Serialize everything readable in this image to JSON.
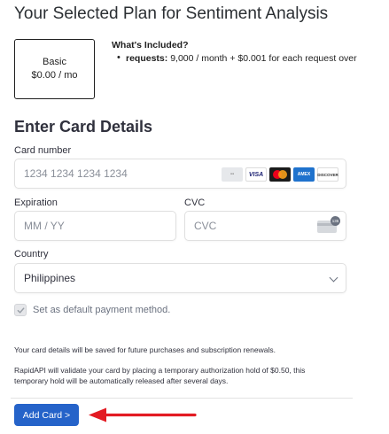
{
  "page_title": "Your Selected Plan for Sentiment Analysis",
  "plan": {
    "name": "Basic",
    "price": "$0.00 / mo"
  },
  "included": {
    "title": "What's Included?",
    "items": [
      {
        "key": "requests:",
        "value": "9,000 / month + $0.001 for each request over"
      }
    ]
  },
  "card_section_title": "Enter Card Details",
  "card_number": {
    "label": "Card number",
    "placeholder": "1234 1234 1234 1234"
  },
  "expiration": {
    "label": "Expiration",
    "placeholder": "MM / YY"
  },
  "cvc": {
    "label": "CVC",
    "placeholder": "CVC",
    "badge": "135"
  },
  "card_logos": {
    "visa": "VISA",
    "amex": "AMEX",
    "discover": "DISCOVER"
  },
  "country": {
    "label": "Country",
    "value": "Philippines"
  },
  "default_payment": {
    "label": "Set as default payment method.",
    "checked": true
  },
  "notes": {
    "save": "Your card details will be saved for future purchases and subscription renewals.",
    "hold_line1": "RapidAPI will validate your card by placing a temporary authorization hold of $0.50, this",
    "hold_line2": "temporary hold will be automatically released after several days."
  },
  "add_card_button": "Add Card >",
  "colors": {
    "primary_button": "#2563c9",
    "arrow": "#e31b23"
  },
  "icons": {
    "dropdown": "chevron-down-icon",
    "checkbox": "check-icon",
    "pointer": "red-arrow-icon"
  }
}
